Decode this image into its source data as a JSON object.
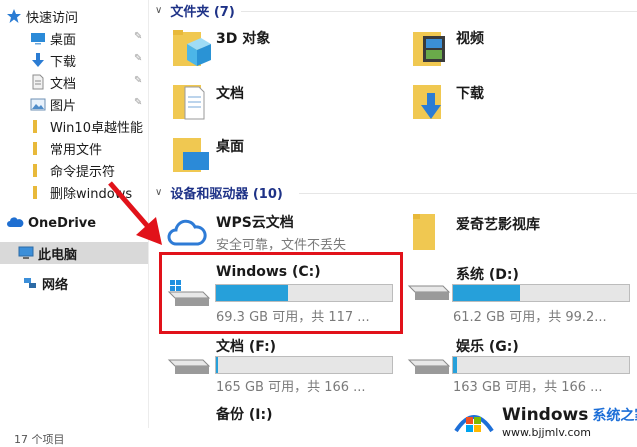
{
  "sidebar": {
    "quick_access": "快速访问",
    "items": [
      {
        "label": "桌面"
      },
      {
        "label": "下载"
      },
      {
        "label": "文档"
      },
      {
        "label": "图片"
      },
      {
        "label": "Win10卓越性能"
      },
      {
        "label": "常用文件"
      },
      {
        "label": "命令提示符"
      },
      {
        "label": "删除windows"
      }
    ],
    "onedrive": "OneDrive",
    "this_pc": "此电脑",
    "network": "网络"
  },
  "folders": {
    "header": "文件夹 (7)",
    "items": [
      {
        "name": "3D 对象"
      },
      {
        "name": "视频"
      },
      {
        "name": "文档"
      },
      {
        "name": "下载"
      },
      {
        "name": "桌面"
      }
    ]
  },
  "devices": {
    "header": "设备和驱动器 (10)",
    "wps": {
      "name": "WPS云文档",
      "sub": "安全可靠，文件不丢失"
    },
    "iqiyi": {
      "name": "爱奇艺影视库"
    },
    "drives": [
      {
        "name": "Windows (C:)",
        "info": "69.3 GB 可用，共 117 ...",
        "used": 0.41
      },
      {
        "name": "系统 (D:)",
        "info": "61.2 GB 可用，共 99.2...",
        "used": 0.38
      },
      {
        "name": "文档 (F:)",
        "info": "165 GB 可用，共 166 ...",
        "used": 0.01
      },
      {
        "name": "娱乐 (G:)",
        "info": "163 GB 可用，共 166 ...",
        "used": 0.02
      },
      {
        "name": "备份 (I:)"
      }
    ]
  },
  "status": {
    "items_count": "17 个项目"
  },
  "watermark": {
    "title": "Windows",
    "title_cn": "系统之家",
    "url": "www.bjjmlv.com"
  },
  "colors": {
    "accent_bar": "#26a0da",
    "highlight": "#e1121a",
    "header_text": "#1e3287"
  }
}
